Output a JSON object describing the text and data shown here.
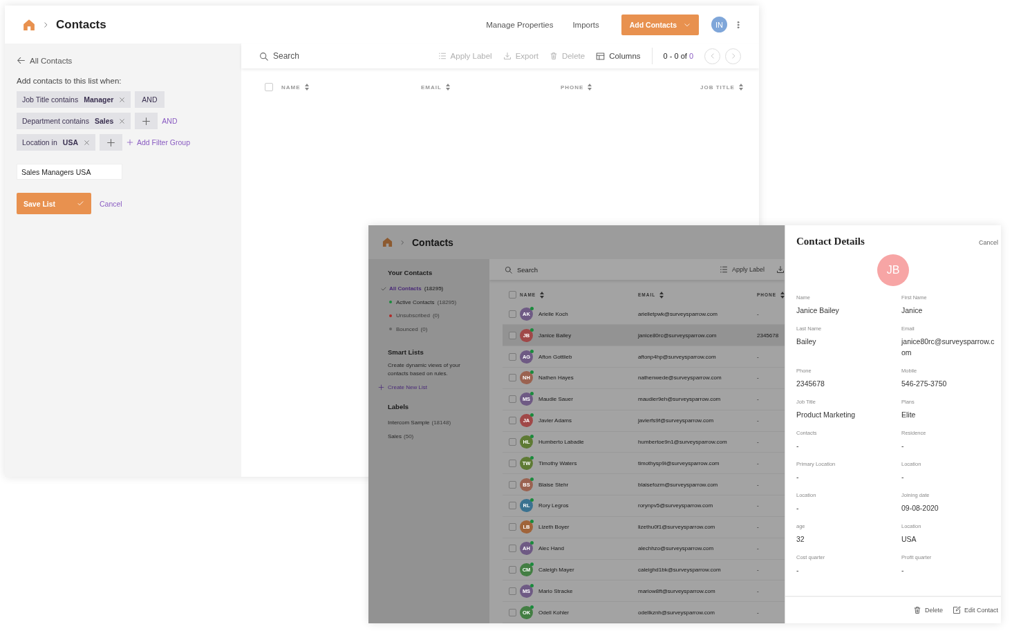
{
  "back_window": {
    "title": "Contacts",
    "header_links": [
      "Manage Properties",
      "Imports"
    ],
    "add_button": "Add Contacts",
    "avatar": "IN",
    "back_link": "All Contacts",
    "rule_prompt": "Add contacts to this list when:",
    "filter_rows": [
      {
        "chip": "Job Title contains **Manager**",
        "kind": "and",
        "action": "AND"
      },
      {
        "chip": "Department contains **Sales**",
        "kind": "plus_link",
        "action": "AND"
      },
      {
        "chip": "Location in **USA**",
        "kind": "plus_group",
        "action": "Add Filter Group"
      }
    ],
    "list_name": "Sales Managers USA",
    "save_button": "Save List",
    "cancel_link": "Cancel",
    "toolbar": {
      "search_placeholder": "Search",
      "actions": [
        {
          "kind": "label",
          "label": "Apply Label",
          "disabled": true
        },
        {
          "kind": "export",
          "label": "Export",
          "disabled": true
        },
        {
          "kind": "delete",
          "label": "Delete",
          "disabled": true
        },
        {
          "kind": "columns",
          "label": "Columns",
          "disabled": false
        }
      ],
      "range": "0 - 0 of",
      "total": "0"
    },
    "select_all_checked": false,
    "columns": [
      "NAME",
      "EMAIL",
      "PHONE",
      "JOB TITLE"
    ]
  },
  "front_window": {
    "title": "Contacts",
    "your_contacts": {
      "heading": "Your Contacts",
      "items": [
        {
          "label": "All Contacts",
          "count": "(18295)",
          "selected": true,
          "disabled": false
        },
        {
          "label": "Active Contacts",
          "count": "(18295)",
          "color": "#1a8a3c",
          "selected": false,
          "disabled": false
        },
        {
          "label": "Unsubscribed",
          "count": "(0)",
          "color": "#b02a28",
          "selected": false,
          "disabled": true
        },
        {
          "label": "Bounced",
          "count": "(0)",
          "color": "#666666",
          "selected": false,
          "disabled": true
        }
      ]
    },
    "smart_lists": {
      "heading": "Smart Lists",
      "description": "Create dynamic views of your contacts based on rules.",
      "link": "Create New List"
    },
    "labels": {
      "heading": "Labels",
      "items": [
        {
          "label": "Intercom Sample",
          "count": "(18148)",
          "selected": false
        },
        {
          "label": "Sales",
          "count": "(50)",
          "selected": false
        }
      ]
    },
    "toolbar": {
      "search_placeholder": "Search",
      "apply_label": "Apply Label"
    },
    "select_all_checked": false,
    "columns": [
      "NAME",
      "EMAIL",
      "PHONE"
    ],
    "rows": [
      {
        "initials": "AK",
        "name": "Arielle Koch",
        "email": "arielletpwk@surveysparrow.com",
        "phone": "-",
        "color": "#6e5a84",
        "active": true,
        "checked": false,
        "selected": false
      },
      {
        "initials": "JB",
        "name": "Janice Bailey",
        "email": "janice80rc@surveysparrow.com",
        "phone": "2345678",
        "color": "#a04848",
        "active": true,
        "checked": false,
        "selected": true
      },
      {
        "initials": "AG",
        "name": "Afton Gottlieb",
        "email": "aftonp4hp@surveysparrow.com",
        "phone": "-",
        "color": "#6e5a84",
        "active": true,
        "checked": false,
        "selected": false
      },
      {
        "initials": "NH",
        "name": "Nathen Hayes",
        "email": "nathenwede@surveysparrow.com",
        "phone": "-",
        "color": "#9a6250",
        "active": true,
        "checked": false,
        "selected": false
      },
      {
        "initials": "MS",
        "name": "Maudie Sauer",
        "email": "maudier9eh@surveysparrow.com",
        "phone": "-",
        "color": "#6e5a84",
        "active": true,
        "checked": false,
        "selected": false
      },
      {
        "initials": "JA",
        "name": "Javier Adams",
        "email": "javierfs9f@surveysparrow.com",
        "phone": "-",
        "color": "#a04848",
        "active": true,
        "checked": false,
        "selected": false
      },
      {
        "initials": "HL",
        "name": "Humberto Labadie",
        "email": "humbertoe9n1@surveysparrow.com",
        "phone": "-",
        "color": "#5e7a34",
        "active": true,
        "checked": false,
        "selected": false
      },
      {
        "initials": "TW",
        "name": "Timothy Waters",
        "email": "timothysp9i@surveysparrow.com",
        "phone": "-",
        "color": "#5e7a34",
        "active": true,
        "checked": false,
        "selected": false
      },
      {
        "initials": "BS",
        "name": "Blaise Stehr",
        "email": "blaisefozm@surveysparrow.com",
        "phone": "-",
        "color": "#9a6250",
        "active": true,
        "checked": false,
        "selected": false
      },
      {
        "initials": "RL",
        "name": "Rory Legros",
        "email": "rorynpv5@surveysparrow.com",
        "phone": "-",
        "color": "#3a7290",
        "active": true,
        "checked": false,
        "selected": false
      },
      {
        "initials": "LB",
        "name": "Lizeth Boyer",
        "email": "lizethu0f1@surveysparrow.com",
        "phone": "-",
        "color": "#a0643a",
        "active": true,
        "checked": false,
        "selected": false
      },
      {
        "initials": "AH",
        "name": "Alec Hand",
        "email": "alechhzo@surveysparrow.com",
        "phone": "-",
        "color": "#6e5a84",
        "active": true,
        "checked": false,
        "selected": false
      },
      {
        "initials": "CM",
        "name": "Caleigh Mayer",
        "email": "caleighd1bk@surveysparrow.com",
        "phone": "-",
        "color": "#437e43",
        "active": true,
        "checked": false,
        "selected": false
      },
      {
        "initials": "MS",
        "name": "Mario Stracke",
        "email": "mariow8ft@surveysparrow.com",
        "phone": "-",
        "color": "#6e5a84",
        "active": true,
        "checked": false,
        "selected": false
      },
      {
        "initials": "OK",
        "name": "Odell Kohler",
        "email": "odellkznh@surveysparrow.com",
        "phone": "-",
        "color": "#437e43",
        "active": true,
        "checked": false,
        "selected": false
      }
    ]
  },
  "contact_details": {
    "title": "Contact Details",
    "cancel": "Cancel",
    "initials": "JB",
    "fields": [
      {
        "label": "Name",
        "value": "Janice Bailey"
      },
      {
        "label": "First Name",
        "value": "Janice"
      },
      {
        "label": "Last Name",
        "value": "Bailey"
      },
      {
        "label": "Email",
        "value": "janice80rc@surveysparrow.com"
      },
      {
        "label": "Phone",
        "value": "2345678"
      },
      {
        "label": "Mobile",
        "value": "546-275-3750"
      },
      {
        "label": "Job Title",
        "value": "Product Marketing"
      },
      {
        "label": "Plans",
        "value": "Elite"
      },
      {
        "label": "Contacts",
        "value": "-"
      },
      {
        "label": "Residence",
        "value": "-"
      },
      {
        "label": "Primary Location",
        "value": "-"
      },
      {
        "label": "Location",
        "value": "-"
      },
      {
        "label": "Location",
        "value": "-"
      },
      {
        "label": "Joining date",
        "value": "09-08-2020"
      },
      {
        "label": "age",
        "value": "32"
      },
      {
        "label": "Location",
        "value": "USA"
      },
      {
        "label": "Cost quarter",
        "value": "-"
      },
      {
        "label": "Profit quarter",
        "value": "-"
      }
    ],
    "actions": [
      {
        "kind": "delete",
        "label": "Delete"
      },
      {
        "kind": "edit",
        "label": "Edit Contact"
      }
    ]
  }
}
